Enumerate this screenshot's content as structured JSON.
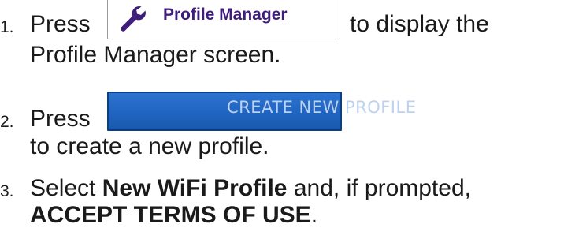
{
  "steps": [
    {
      "number": "1.",
      "before": "Press",
      "after": "to display the",
      "line2": "Profile Manager screen.",
      "button": {
        "label": "Profile Manager",
        "icon": "wrench-icon"
      }
    },
    {
      "number": "2.",
      "before": "Press",
      "line2": "to create a new profile.",
      "button": {
        "label": "CREATE NEW PROFILE"
      }
    },
    {
      "number": "3.",
      "line1_pre": "Select",
      "line1_bold": "New WiFi Profile",
      "line1_post": "and, if prompted,",
      "line2_bold": "ACCEPT TERMS OF USE",
      "line2_post": "."
    }
  ],
  "colors": {
    "text": "#1a1a1a",
    "profile_label": "#3f1d7a",
    "create_button_bg": "#1f63bf",
    "create_button_text": "#bcd2ee"
  }
}
